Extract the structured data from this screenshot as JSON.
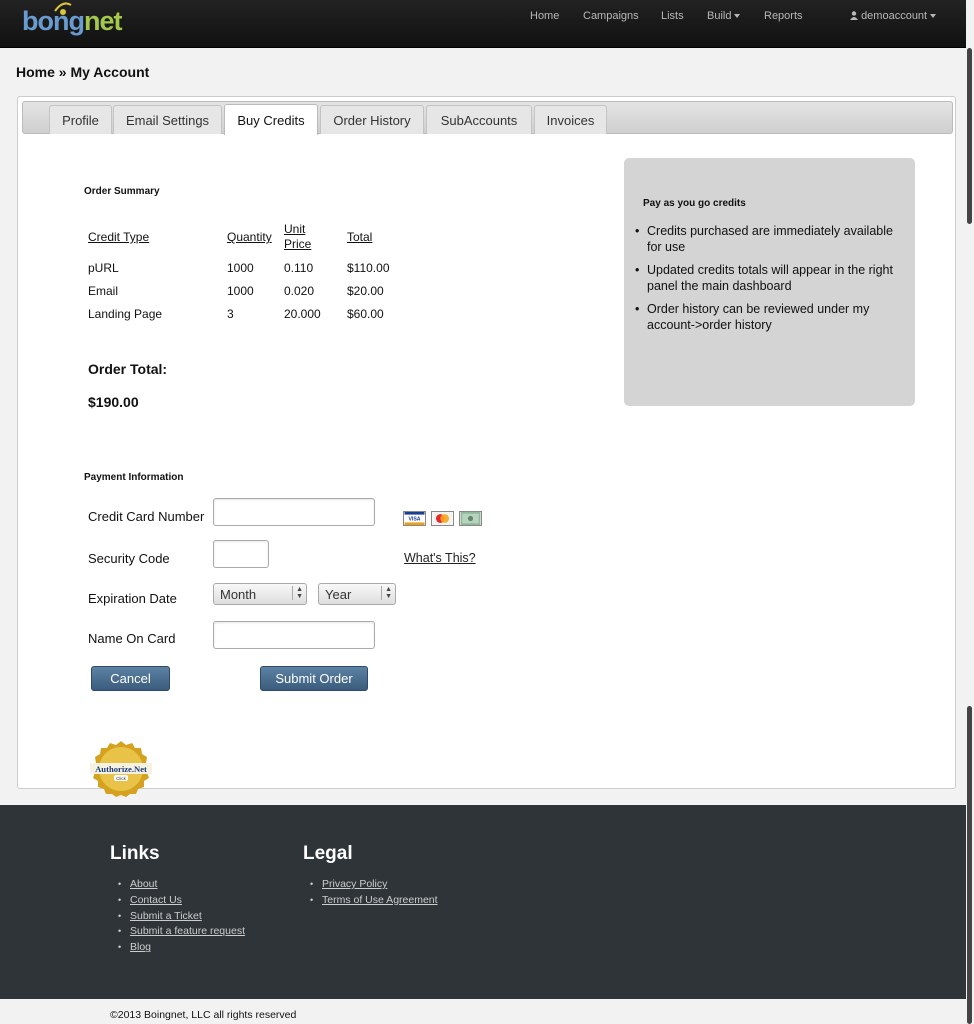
{
  "brand": {
    "logo_text_1": "bo",
    "logo_text_2": "ng",
    "logo_text_3": "net"
  },
  "nav": {
    "home": "Home",
    "campaigns": "Campaigns",
    "lists": "Lists",
    "build": "Build",
    "reports": "Reports",
    "account": "demoaccount"
  },
  "breadcrumb": "Home » My Account",
  "tabs": [
    "Profile",
    "Email Settings",
    "Buy Credits",
    "Order History",
    "SubAccounts",
    "Invoices"
  ],
  "order_summary": {
    "heading": "Order Summary",
    "columns": {
      "credit_type": "Credit Type",
      "quantity": "Quantity",
      "unit_price_1": "Unit",
      "unit_price_2": "Price",
      "total": "Total"
    },
    "rows": [
      {
        "type": "pURL",
        "qty": "1000",
        "price": "0.110",
        "total": "$110.00"
      },
      {
        "type": "Email",
        "qty": "1000",
        "price": "0.020",
        "total": "$20.00"
      },
      {
        "type": "Landing Page",
        "qty": "3",
        "price": "20.000",
        "total": "$60.00"
      }
    ],
    "order_total_label": "Order Total:",
    "order_total_value": "$190.00"
  },
  "info_box": {
    "title": "Pay as you go credits",
    "items": [
      "Credits purchased are immediately available for use",
      "Updated credits totals will appear in the right panel the main dashboard",
      "Order history can be reviewed under my account->order history"
    ]
  },
  "payment": {
    "heading": "Payment Information",
    "card_number_label": "Credit Card Number",
    "card_number_value": "",
    "security_code_label": "Security Code",
    "security_code_value": "",
    "whats_this": "What's This?",
    "expiration_label": "Expiration Date",
    "month_selected": "Month",
    "year_selected": "Year",
    "name_label": "Name On Card",
    "name_value": "",
    "cancel": "Cancel",
    "submit": "Submit Order",
    "card_icons": [
      "visa-icon",
      "mastercard-icon",
      "amex-icon"
    ],
    "seal_text_1": "Authorize.Net",
    "seal_text_2": "Click"
  },
  "footer": {
    "links_heading": "Links",
    "links": [
      "About",
      "Contact Us",
      "Submit a Ticket",
      "Submit a feature request",
      "Blog"
    ],
    "legal_heading": "Legal",
    "legal": [
      "Privacy Policy",
      "Terms of Use Agreement"
    ],
    "copyright": "©2013 Boingnet, LLC all rights reserved"
  },
  "colors": {
    "navbar": "#1a1a1a",
    "button": "#4a6d8e",
    "footer": "#2f3438",
    "info_box": "#d4d4d4"
  }
}
